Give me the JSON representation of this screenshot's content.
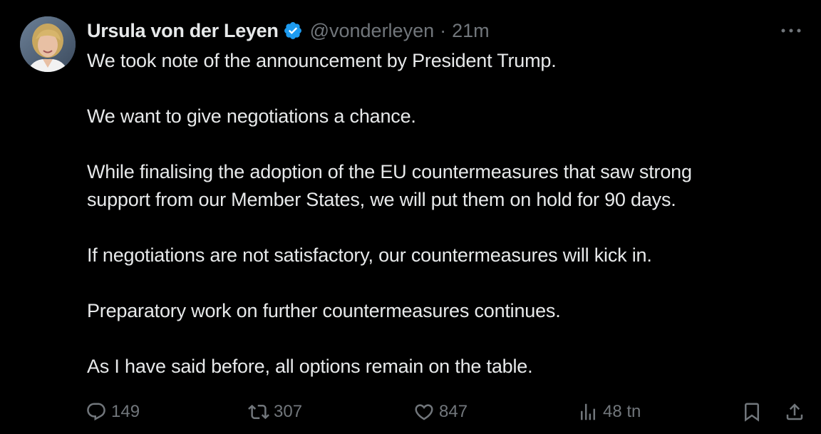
{
  "tweet": {
    "author": {
      "display_name": "Ursula von der Leyen",
      "handle": "@vonderleyen",
      "verified": true,
      "verified_color": "#1d9bf0"
    },
    "separator": "·",
    "time": "21m",
    "more_icon": "more-horizontal-icon",
    "paragraphs": [
      [
        "We took note of the announcement by President Trump."
      ],
      [
        "We want to give negotiations a chance."
      ],
      [
        "While finalising the adoption of the EU countermeasures that saw strong",
        "support from our Member States, we will put them on hold for 90 days."
      ],
      [
        "If negotiations are not satisfactory, our countermeasures will kick in."
      ],
      [
        "Preparatory work on further countermeasures continues."
      ],
      [
        "As I have said before, all options remain on the table."
      ]
    ],
    "actions": {
      "reply": {
        "icon": "reply-icon",
        "count": "149"
      },
      "retweet": {
        "icon": "retweet-icon",
        "count": "307"
      },
      "like": {
        "icon": "heart-icon",
        "count": "847"
      },
      "views": {
        "icon": "views-icon",
        "count": "48 tn"
      },
      "bookmark": {
        "icon": "bookmark-icon"
      },
      "share": {
        "icon": "share-icon"
      }
    }
  },
  "colors": {
    "background": "#000000",
    "text_primary": "#e7e9ea",
    "text_secondary": "#71767b"
  }
}
